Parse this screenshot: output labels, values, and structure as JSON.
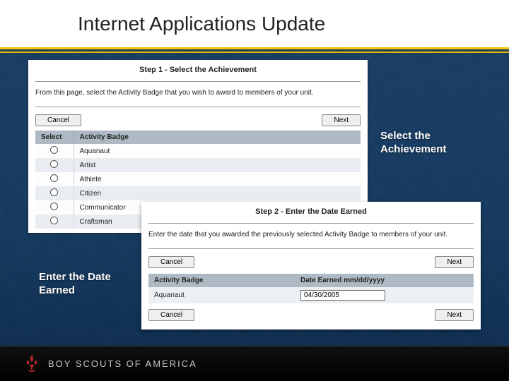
{
  "title": "Internet Applications Update",
  "callouts": {
    "select_achievement": "Select the Achievement",
    "enter_date": "Enter the Date Earned"
  },
  "panel1": {
    "step_title": "Step 1 - Select the Achievement",
    "instructions": "From this page, select the Activity Badge that you wish to award to members of your unit.",
    "cancel": "Cancel",
    "next": "Next",
    "headers": {
      "select": "Select",
      "badge": "Activity Badge"
    },
    "rows": [
      "Aquanaut",
      "Artist",
      "Athlete",
      "Citizen",
      "Communicator",
      "Craftsman"
    ]
  },
  "panel2": {
    "step_title": "Step 2 - Enter the Date Earned",
    "instructions": "Enter the date that you awarded the previously selected Activity Badge to members of your unit.",
    "cancel": "Cancel",
    "next": "Next",
    "headers": {
      "badge": "Activity Badge",
      "date": "Date Earned mm/dd/yyyy"
    },
    "row": {
      "badge": "Aquanaut",
      "date": "04/30/2005"
    }
  },
  "footer": {
    "org": "BOY SCOUTS OF AMERICA"
  }
}
